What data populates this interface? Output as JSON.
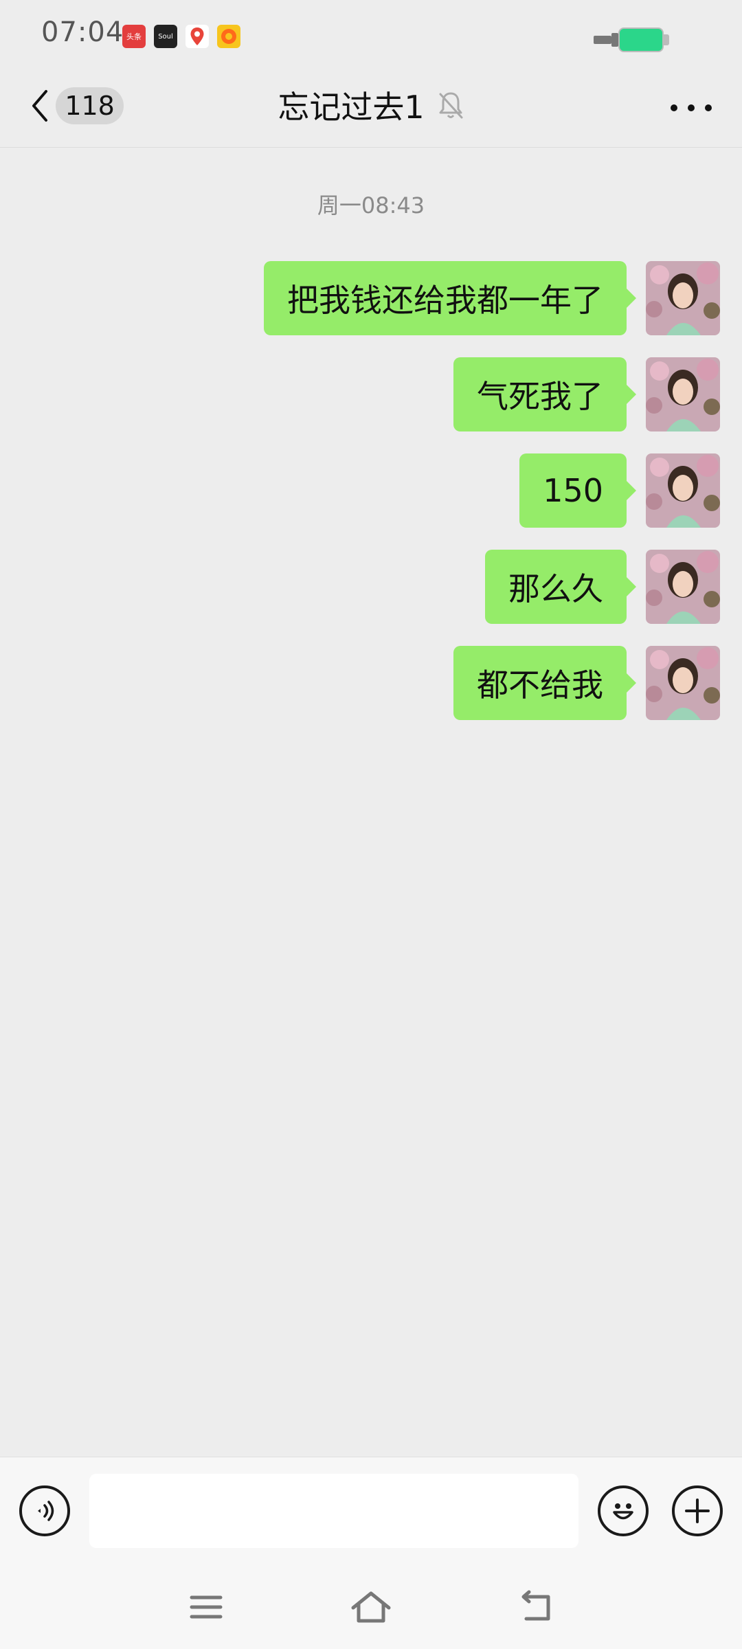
{
  "status_bar": {
    "time": "07:04",
    "apps": [
      {
        "name": "toutiao-icon",
        "label": "头条"
      },
      {
        "name": "soul-icon",
        "label": "Soul"
      },
      {
        "name": "map-pin-app-icon",
        "label": ""
      },
      {
        "name": "kuaishou-icon",
        "label": ""
      }
    ]
  },
  "header": {
    "unread_count": "118",
    "title": "忘记过去1"
  },
  "conversation": {
    "timestamp": "周一08:43",
    "messages": [
      {
        "text": "把我钱还给我都一年了",
        "sender": "self"
      },
      {
        "text": "气死我了",
        "sender": "self"
      },
      {
        "text": "150",
        "sender": "self"
      },
      {
        "text": "那么久",
        "sender": "self"
      },
      {
        "text": "都不给我",
        "sender": "self"
      }
    ]
  },
  "input": {
    "value": "",
    "placeholder": ""
  },
  "colors": {
    "background": "#ededed",
    "bubble_self": "#95ec69",
    "battery": "#2bd68a"
  }
}
